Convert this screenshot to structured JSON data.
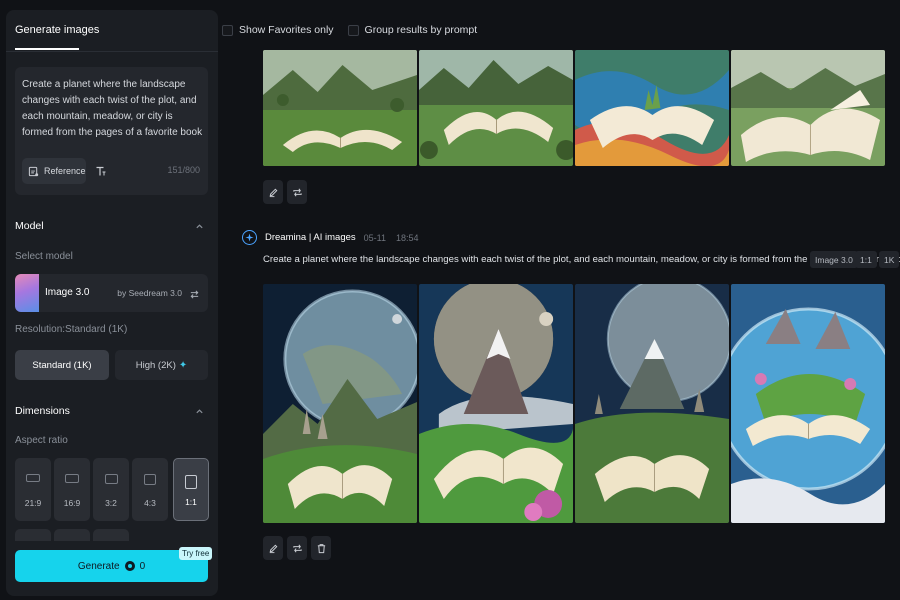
{
  "sidebar": {
    "tab_label": "Generate images",
    "prompt_text": "Create a planet where the landscape changes with each twist of the plot, and each mountain, meadow, or city is formed from the pages of a favorite book",
    "reference_label": "Reference",
    "char_count": "151/800",
    "model": {
      "section_title": "Model",
      "select_label": "Select model",
      "name": "Image 3.0",
      "by": "by Seedream 3.0"
    },
    "resolution": {
      "label": "Resolution:Standard (1K)",
      "options": [
        "Standard (1K)",
        "High (2K)"
      ],
      "selected": "Standard (1K)"
    },
    "dimensions": {
      "section_title": "Dimensions",
      "aspect_label": "Aspect ratio",
      "ratios": [
        "21:9",
        "16:9",
        "3:2",
        "4:3",
        "1:1"
      ],
      "selected": "1:1"
    },
    "generate": {
      "label": "Generate",
      "cost": "0",
      "badge": "Try free"
    }
  },
  "main": {
    "filters": {
      "favorites": "Show Favorites only",
      "group": "Group results by prompt"
    },
    "generation": {
      "author": "Dreamina | AI images",
      "date": "05-11",
      "time": "18:54",
      "prompt": "Create a planet where the landscape changes with each twist of the plot, and each mountain, meadow, or city is formed from the pages of a favorite book",
      "tags": [
        "Image 3.0",
        "1:1",
        "1K"
      ]
    }
  },
  "icons": {
    "edit": "pencil-icon",
    "regenerate": "repeat-icon",
    "delete": "trash-icon",
    "reference": "image-reference-icon",
    "text_style": "text-icon",
    "switch": "arrows-switch-icon",
    "collapse": "chevron-up-icon",
    "sparkle": "sparkle-icon",
    "brand": "star-badge-icon"
  },
  "colors": {
    "accent": "#16d3ec",
    "brand_blue": "#4ba3ff",
    "panel": "#1b1e23",
    "background": "#101216"
  }
}
